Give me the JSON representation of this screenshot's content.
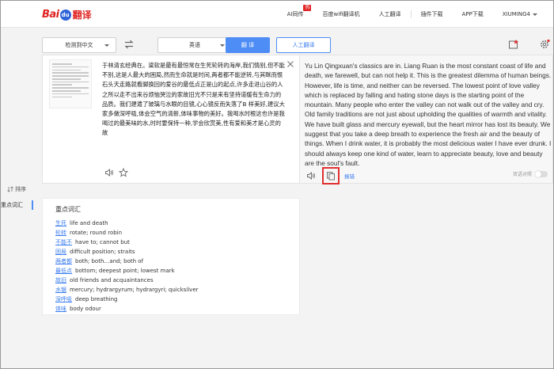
{
  "logo": {
    "text": "Bai",
    "paw": "du",
    "suffix": "翻译"
  },
  "nav": {
    "items": [
      "AI同传",
      "百度wifi翻译机",
      "人工翻译",
      "插件下载",
      "APP下载"
    ],
    "badge": "热",
    "user": "XIUMING4"
  },
  "toolbar": {
    "source_lang": "检测到中文",
    "target_lang": "英语",
    "translate_label": "翻 译",
    "human_label": "人工翻译"
  },
  "source": {
    "text": "于林清玄经典在。梁软是最有最恒常在生死轮转的海岸,我们情别,但不能不别,这是人最大的困局,然而生命就是时间,两者都不能逆转,与其眯而恨石头天走路就看脚换回的爱谷的最低点正是山的起点,许多走进山谷的人之所以走不出来谷烦恼哭泣的家故旧光不只是来有坚持道缓有生命力的品质。我们建遣了玻璃与水眼的目镜,心心镜反而失落了B 样美好,建议大家多做深呼吸,体会空气的清新,体味事物的美好。我喝水时根这也许是我喝过的最美味的水,时时要保持一种,学会欣赏美,性有爱和美才是心灵的故"
  },
  "target": {
    "text": "Yu Lin Qingxuan's classics are in. Liang Ruan is the most constant coast of life and death, we farewell, but can not help it. This is the greatest dilemma of human beings. However, life is time, and neither can be reversed. The lowest point of love valley which is replaced by falling and hating stone days is the starting point of the mountain. Many people who enter the valley can not walk out of the valley and cry. Old family traditions are not just about upholding the qualities of warmth and vitality. We have built glass and mercury eyewall, but the heart mirror has lost its beauty. We suggest that you take a deep breath to experience the fresh air and the beauty of things. When I drink water, it is probably the most delicious water I have ever drunk. I should always keep one kind of water, learn to appreciate beauty, love and beauty are the soul's fault.",
    "report_label": "报错",
    "bilingual_label": "双语对照"
  },
  "side": {
    "sort_label": "排序",
    "tab_label": "重点词汇"
  },
  "vocab": {
    "title": "重点词汇",
    "items": [
      {
        "term": "生死",
        "def": "life and death"
      },
      {
        "term": "轮转",
        "def": "rotate; round robin"
      },
      {
        "term": "不能不",
        "def": "have to; cannot but"
      },
      {
        "term": "困局",
        "def": "difficult position; straits"
      },
      {
        "term": "两者都",
        "def": "both; both…and; both of"
      },
      {
        "term": "最低点",
        "def": "bottom; deepest point; lowest mark"
      },
      {
        "term": "故旧",
        "def": "old friends and acquaintances"
      },
      {
        "term": "水银",
        "def": "mercury; hydrargyrum; hydrargyri; quicksilver"
      },
      {
        "term": "深呼吸",
        "def": "deep breathing"
      },
      {
        "term": "体味",
        "def": "body odour"
      }
    ]
  },
  "colors": {
    "accent": "#4e8df5",
    "highlight": "#e03030",
    "brand_red": "#e02323"
  }
}
